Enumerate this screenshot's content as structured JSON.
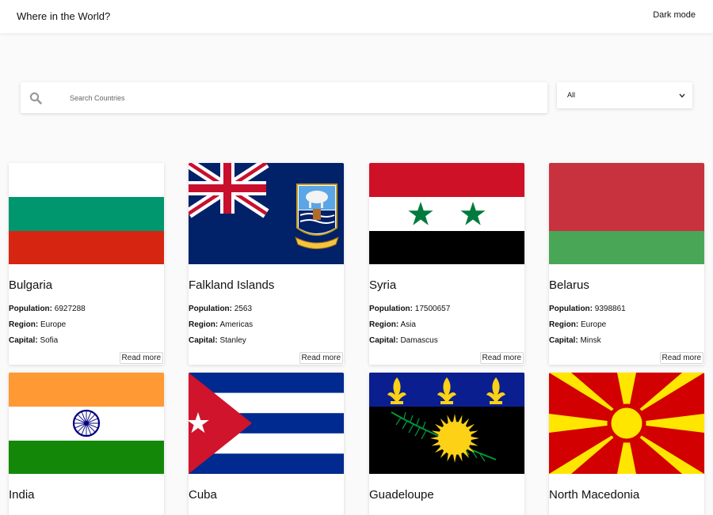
{
  "header": {
    "title": "Where in the World?",
    "mode_label": "Dark mode"
  },
  "search": {
    "placeholder": "Search Countries"
  },
  "filter": {
    "selected": "All"
  },
  "labels": {
    "population": "Population:",
    "region": "Region:",
    "capital": "Capital:",
    "read_more": "Read more"
  },
  "countries": [
    {
      "name": "Bulgaria",
      "population": "6927288",
      "region": "Europe",
      "capital": "Sofia"
    },
    {
      "name": "Falkland Islands",
      "population": "2563",
      "region": "Americas",
      "capital": "Stanley"
    },
    {
      "name": "Syria",
      "population": "17500657",
      "region": "Asia",
      "capital": "Damascus"
    },
    {
      "name": "Belarus",
      "population": "9398861",
      "region": "Europe",
      "capital": "Minsk"
    },
    {
      "name": "India"
    },
    {
      "name": "Cuba"
    },
    {
      "name": "Guadeloupe"
    },
    {
      "name": "North Macedonia"
    }
  ],
  "colors": {
    "bulgaria_green": "#00966e",
    "bulgaria_red": "#d62612",
    "falkland_blue": "#012169",
    "syria_red": "#ce1126",
    "syria_green": "#007a3d",
    "belarus_red": "#c8313e",
    "belarus_green": "#4aa657",
    "india_saffron": "#ff9933",
    "india_green": "#138808",
    "india_chakra": "#000080",
    "cuba_blue": "#002a8f",
    "cuba_red": "#cf142b",
    "guadeloupe_blue": "#0b1e8f",
    "guadeloupe_yellow": "#fcd116",
    "guadeloupe_green": "#009739",
    "macedonia_red": "#d20000",
    "macedonia_yellow": "#ffe600"
  }
}
